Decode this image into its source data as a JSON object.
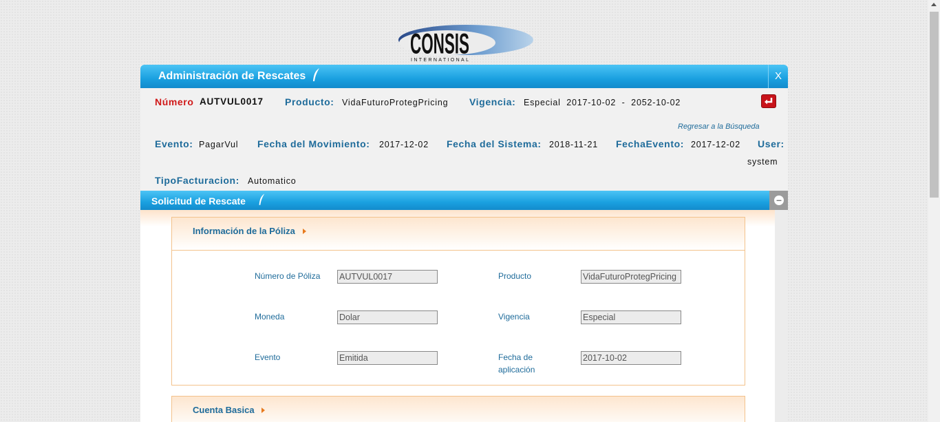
{
  "logo": {
    "text": "CONSIS",
    "subtext": "INTERNATIONAL"
  },
  "window": {
    "title": "Administración de Rescates",
    "close_label": "X"
  },
  "header": {
    "numero_label": "Número",
    "numero_value": "AUTVUL0017",
    "producto_label": "Producto:",
    "producto_value": "VidaFuturoProtegPricing",
    "vigencia_label": "Vigencia:",
    "vigencia_value": "Especial  2017-10-02  -  2052-10-02",
    "back_link": "Regresar a la Búsqueda",
    "evento_label": "Evento:",
    "evento_value": "PagarVul",
    "fecha_mov_label": "Fecha del Movimiento:",
    "fecha_mov_value": "2017-12-02",
    "fecha_sis_label": "Fecha del Sistema:",
    "fecha_sis_value": "2018-11-21",
    "fecha_evento_label": "FechaEvento:",
    "fecha_evento_value": "2017-12-02",
    "user_label": "User:",
    "user_value": "system",
    "tipo_fact_label": "TipoFacturacion:",
    "tipo_fact_value": "Automatico"
  },
  "section": {
    "title": "Solicitud de Rescate"
  },
  "poliza": {
    "title": "Información de la Póliza",
    "fields": {
      "numero_label": "Número de Póliza",
      "numero_value": "AUTVUL0017",
      "producto_label": "Producto",
      "producto_value": "VidaFuturoProtegPricing",
      "moneda_label": "Moneda",
      "moneda_value": "Dolar",
      "vigencia_label": "Vigencia",
      "vigencia_value": "Especial",
      "evento_label": "Evento",
      "evento_value": "Emitida",
      "fecha_aplic_label_1": "Fecha de",
      "fecha_aplic_label_2": "aplicación",
      "fecha_aplic_value": "2017-10-02"
    }
  },
  "cuenta": {
    "title": "Cuenta Basica"
  },
  "icons": {
    "back": "return-arrow-icon",
    "quill": "quill-icon",
    "collapse": "minus-circle-icon"
  },
  "colors": {
    "accent": "#1aa0e0",
    "label": "#1e6b9a",
    "highlight": "#d01818",
    "border": "#f3c28b"
  }
}
